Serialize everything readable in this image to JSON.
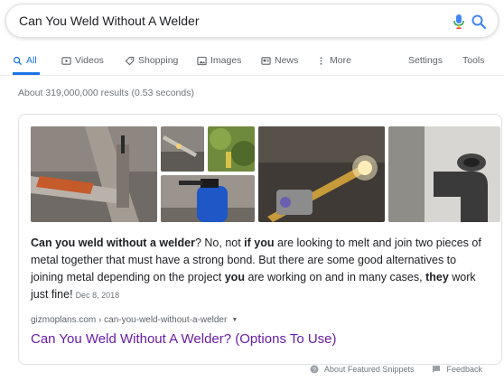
{
  "search": {
    "query": "Can You Weld Without A Welder",
    "mic_icon": "mic-icon",
    "search_icon": "search-icon"
  },
  "tabs": [
    {
      "label": "All",
      "icon": "search-icon",
      "active": true
    },
    {
      "label": "Videos",
      "icon": "video-icon",
      "active": false
    },
    {
      "label": "Shopping",
      "icon": "tag-icon",
      "active": false
    },
    {
      "label": "Images",
      "icon": "image-icon",
      "active": false
    },
    {
      "label": "News",
      "icon": "news-icon",
      "active": false
    },
    {
      "label": "More",
      "icon": "more-vertical-icon",
      "active": false
    }
  ],
  "tools": {
    "settings": "Settings",
    "tools": "Tools"
  },
  "results_stats": "About 319,000,000 results (0.53 seconds)",
  "featured_snippet": {
    "segments": [
      {
        "text": "Can you weld without a welder",
        "bold": true
      },
      {
        "text": "? No, not ",
        "bold": false
      },
      {
        "text": "if you",
        "bold": true
      },
      {
        "text": " are looking to melt and join two pieces of metal together that must have a strong bond. But there are some good alternatives to joining metal depending on the project ",
        "bold": false
      },
      {
        "text": "you",
        "bold": true
      },
      {
        "text": " are working on and in many cases, ",
        "bold": false
      },
      {
        "text": "they",
        "bold": true
      },
      {
        "text": " work just fine!",
        "bold": false
      }
    ],
    "date": "Dec 8, 2018",
    "url": "gizmoplans.com › can-you-weld-without-a-welder",
    "title": "Can You Weld Without A Welder? (Options To Use)"
  },
  "footer": {
    "about": "About Featured Snippets",
    "feedback": "Feedback"
  },
  "colors": {
    "accent": "#1a73e8",
    "visited_link": "#681da8",
    "muted": "#70757a"
  }
}
